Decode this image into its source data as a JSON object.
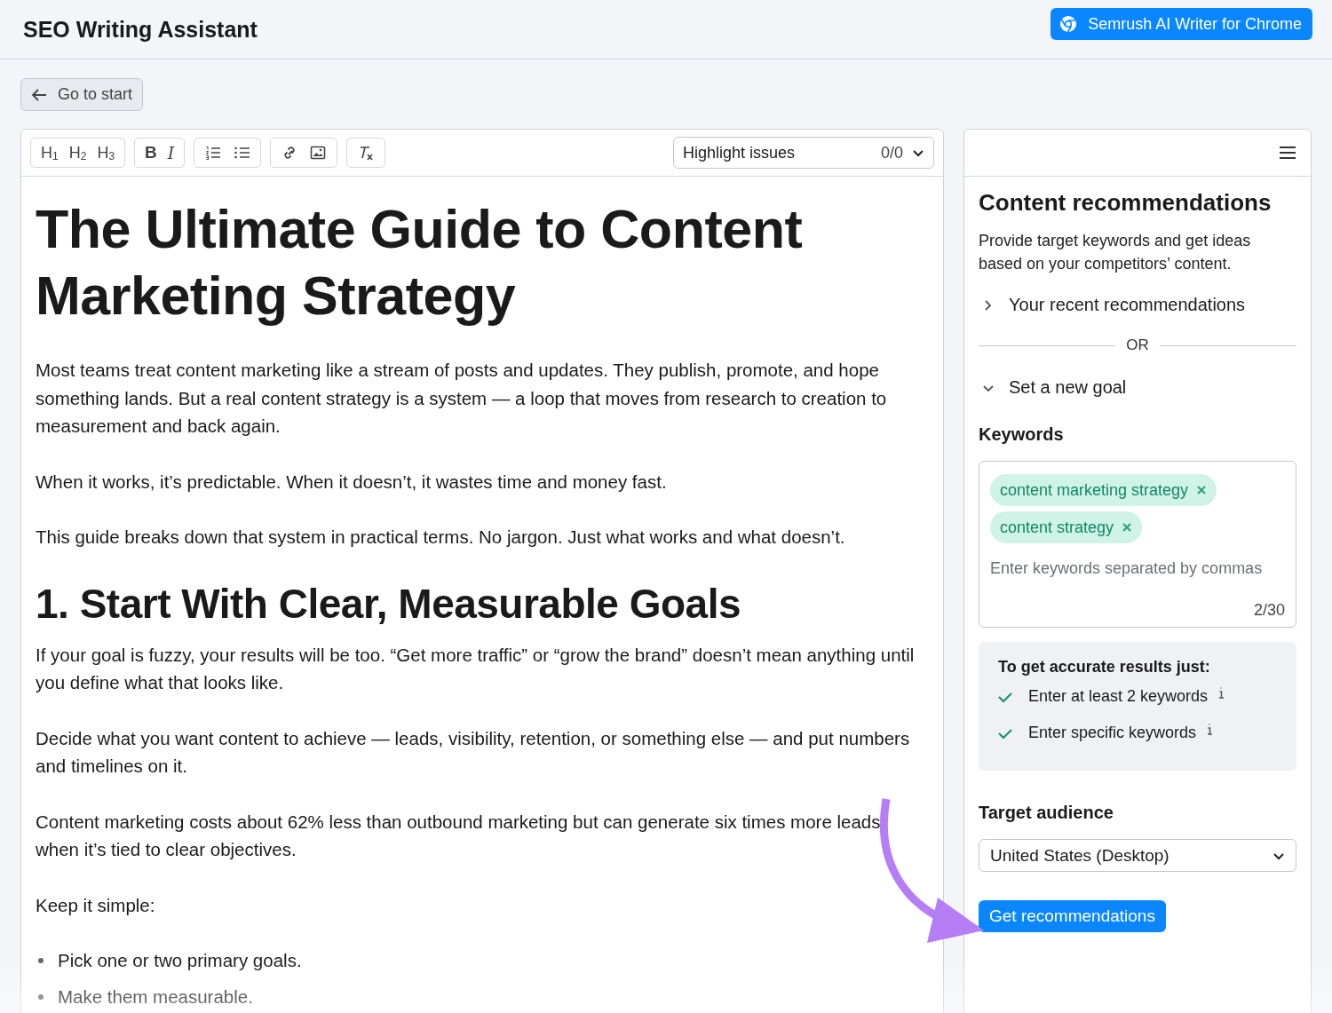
{
  "header": {
    "title": "SEO Writing Assistant",
    "chrome_button": "Semrush AI Writer for Chrome"
  },
  "back_button": "Go to start",
  "toolbar": {
    "groups": [
      [
        {
          "kind": "text",
          "label": "H$_{1}$"
        },
        {
          "kind": "text",
          "label": "H$_{2}$"
        },
        {
          "kind": "text",
          "label": "H$_{3}$"
        }
      ],
      [
        {
          "kind": "bold",
          "label": "B"
        },
        {
          "kind": "italic",
          "label": "I"
        }
      ],
      [
        {
          "kind": "ordered-list"
        },
        {
          "kind": "bullet-list"
        }
      ],
      [
        {
          "kind": "link"
        },
        {
          "kind": "image"
        }
      ],
      [
        {
          "kind": "clear-format"
        }
      ]
    ],
    "highlight": {
      "label": "Highlight issues",
      "count": "0/0"
    }
  },
  "document": [
    {
      "kind": "h1",
      "text": "The Ultimate Guide to Content Marketing Strategy"
    },
    {
      "kind": "p",
      "text": "Most teams treat content marketing like a stream of posts and updates. They publish, promote, and hope something lands. But a real content strategy is a system — a loop that moves from research to creation to measurement and back again."
    },
    {
      "kind": "p",
      "text": "When it works, it’s predictable. When it doesn’t, it wastes time and money fast."
    },
    {
      "kind": "p",
      "text": "This guide breaks down that system in practical terms. No jargon. Just what works and what doesn’t."
    },
    {
      "kind": "h2",
      "text": "1. Start With Clear, Measurable Goals"
    },
    {
      "kind": "p",
      "text": "If your goal is fuzzy, your results will be too. “Get more traffic” or “grow the brand” doesn’t mean anything until you define what that looks like."
    },
    {
      "kind": "p",
      "text": "Decide what you want content to achieve — leads, visibility, retention, or something else — and put numbers and timelines on it."
    },
    {
      "kind": "p",
      "text": "Content marketing costs about 62% less than outbound marketing but can generate six times more leads when it’s tied to clear objectives."
    },
    {
      "kind": "p",
      "text": "Keep it simple:"
    },
    {
      "kind": "bullet",
      "text": "Pick one or two primary goals."
    },
    {
      "kind": "bullet",
      "text": "Make them measurable."
    }
  ],
  "sidebar": {
    "title": "Content recommendations",
    "description": "Provide target keywords and get ideas based on your competitors’ content.",
    "sections": [
      {
        "label": "Your recent recommendations",
        "expanded": false
      }
    ],
    "or": "OR",
    "goal": {
      "label": "Set a new goal",
      "expanded": true
    },
    "keywords_heading": "Keywords",
    "keywords": [
      "content marketing strategy",
      "content strategy"
    ],
    "keywords_placeholder": "Enter keywords separated by commas",
    "keywords_count": "2/30",
    "tips_title": "To get accurate results just:",
    "tips": [
      {
        "text": "Enter at least 2 keywords",
        "checked": true
      },
      {
        "text": "Enter specific keywords",
        "checked": true
      }
    ],
    "audience_heading": "Target audience",
    "audience_value": "United States (Desktop)",
    "submit": "Get recommendations"
  }
}
